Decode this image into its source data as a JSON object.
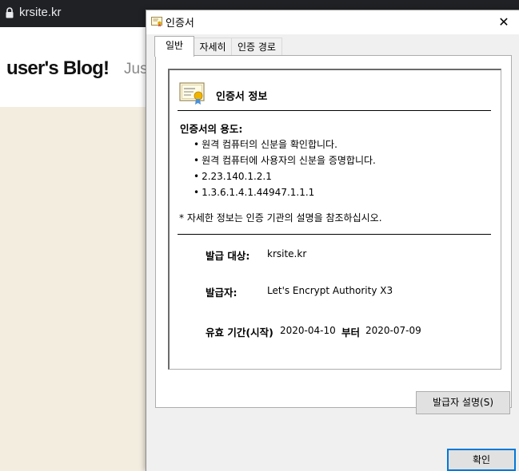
{
  "browser": {
    "url": "krsite.kr",
    "blog_title": "user's Blog!",
    "blog_tagline": "Jus"
  },
  "dialog": {
    "title": "인증서",
    "close_label": "✕",
    "tabs": [
      {
        "label": "일반",
        "active": true
      },
      {
        "label": "자세히",
        "active": false
      },
      {
        "label": "인증 경로",
        "active": false
      }
    ],
    "info_title": "인증서 정보",
    "purpose_title": "인증서의 용도:",
    "purposes": [
      "원격 컴퓨터의 신분을 확인합니다.",
      "원격 컴퓨터에 사용자의 신분을 증명합니다.",
      "2.23.140.1.2.1",
      "1.3.6.1.4.1.44947.1.1.1"
    ],
    "note": "* 자세한 정보는 인증 기관의 설명을 참조하십시오.",
    "issued_to_label": "발급 대상:",
    "issued_to_value": "krsite.kr",
    "issued_by_label": "발급자:",
    "issued_by_value": "Let's Encrypt Authority X3",
    "valid_label": "유효 기간(시작)",
    "valid_from": "2020-04-10",
    "valid_to_label": "부터",
    "valid_to": "2020-07-09",
    "issuer_statement_button": "발급자 설명(S)",
    "ok_button": "확인"
  },
  "colors": {
    "addressbar": "#202124",
    "blog_background": "#f3ede0",
    "dialog_background": "#f0f0f0",
    "focus_border": "#0078d7"
  }
}
